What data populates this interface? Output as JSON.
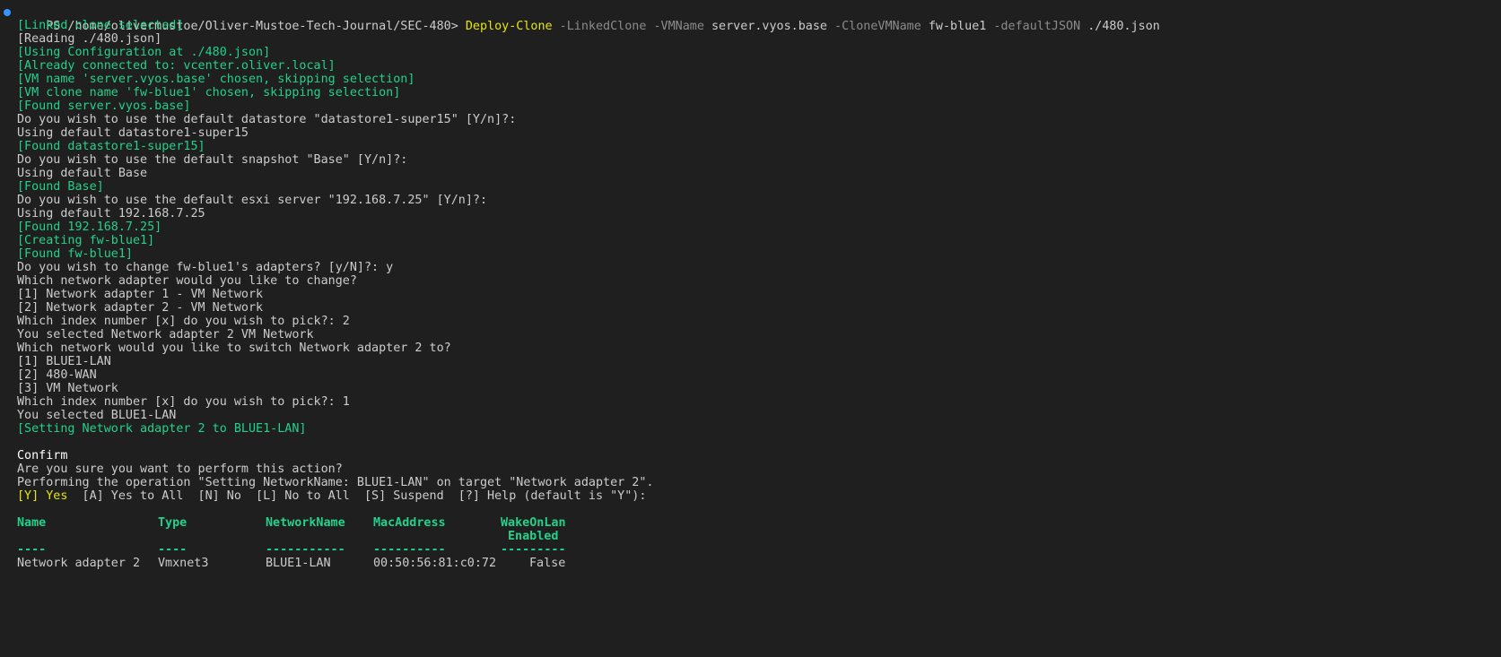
{
  "prompt": {
    "path": "PS /home/olivermustoe/Oliver-Mustoe-Tech-Journal/SEC-480>",
    "command": "Deploy-Clone",
    "args": [
      {
        "flag": "-LinkedClone",
        "value": ""
      },
      {
        "flag": "-VMName",
        "value": "server.vyos.base"
      },
      {
        "flag": "-CloneVMName",
        "value": "fw-blue1"
      },
      {
        "flag": "-defaultJSON",
        "value": "./480.json"
      }
    ]
  },
  "output": [
    {
      "text": "[Linked clone selected]",
      "color": "#23d18b"
    },
    {
      "text": "[Reading ./480.json]",
      "color": "#cccccc"
    },
    {
      "text": "[Using Configuration at ./480.json]",
      "color": "#23d18b"
    },
    {
      "text": "[Already connected to: vcenter.oliver.local]",
      "color": "#23d18b"
    },
    {
      "text": "[VM name 'server.vyos.base' chosen, skipping selection]",
      "color": "#23d18b"
    },
    {
      "text": "[VM clone name 'fw-blue1' chosen, skipping selection]",
      "color": "#23d18b"
    },
    {
      "text": "[Found server.vyos.base]",
      "color": "#23d18b"
    },
    {
      "text": "Do you wish to use the default datastore \"datastore1-super15\" [Y/n]?:",
      "color": "#cccccc"
    },
    {
      "text": "Using default datastore1-super15",
      "color": "#cccccc"
    },
    {
      "text": "[Found datastore1-super15]",
      "color": "#23d18b"
    },
    {
      "text": "Do you wish to use the default snapshot \"Base\" [Y/n]?:",
      "color": "#cccccc"
    },
    {
      "text": "Using default Base",
      "color": "#cccccc"
    },
    {
      "text": "[Found Base]",
      "color": "#23d18b"
    },
    {
      "text": "Do you wish to use the default esxi server \"192.168.7.25\" [Y/n]?:",
      "color": "#cccccc"
    },
    {
      "text": "Using default 192.168.7.25",
      "color": "#cccccc"
    },
    {
      "text": "[Found 192.168.7.25]",
      "color": "#23d18b"
    },
    {
      "text": "[Creating fw-blue1]",
      "color": "#23d18b"
    },
    {
      "text": "[Found fw-blue1]",
      "color": "#23d18b"
    },
    {
      "text": "Do you wish to change fw-blue1's adapters? [y/N]?: y",
      "color": "#cccccc"
    },
    {
      "text": "Which network adapter would you like to change?",
      "color": "#cccccc"
    },
    {
      "text": "[1] Network adapter 1 - VM Network",
      "color": "#cccccc"
    },
    {
      "text": "[2] Network adapter 2 - VM Network",
      "color": "#cccccc"
    },
    {
      "text": "Which index number [x] do you wish to pick?: 2",
      "color": "#cccccc"
    },
    {
      "text": "You selected Network adapter 2 VM Network",
      "color": "#cccccc"
    },
    {
      "text": "Which network would you like to switch Network adapter 2 to?",
      "color": "#cccccc"
    },
    {
      "text": "[1] BLUE1-LAN",
      "color": "#cccccc"
    },
    {
      "text": "[2] 480-WAN",
      "color": "#cccccc"
    },
    {
      "text": "[3] VM Network",
      "color": "#cccccc"
    },
    {
      "text": "Which index number [x] do you wish to pick?: 1",
      "color": "#cccccc"
    },
    {
      "text": "You selected BLUE1-LAN",
      "color": "#cccccc"
    },
    {
      "text": "[Setting Network adapter 2 to BLUE1-LAN]",
      "color": "#23d18b"
    },
    {
      "text": "",
      "color": "#cccccc"
    },
    {
      "text": "Confirm",
      "color": "#ffffff"
    },
    {
      "text": "Are you sure you want to perform this action?",
      "color": "#cccccc"
    },
    {
      "text": "Performing the operation \"Setting NetworkName: BLUE1-LAN\" on target \"Network adapter 2\".",
      "color": "#cccccc"
    }
  ],
  "confirm_choices": {
    "yes": "[Y] Yes",
    "rest": "  [A] Yes to All  [N] No  [L] No to All  [S] Suspend  [?] Help (default is \"Y\"):"
  },
  "table": {
    "headers": [
      "Name",
      "Type",
      "NetworkName",
      "MacAddress",
      "WakeOnLan"
    ],
    "header_second_line": "Enabled",
    "separators": [
      "----",
      "----",
      "-----------",
      "----------",
      "---------"
    ],
    "rows": [
      [
        "Network adapter 2",
        "Vmxnet3",
        "BLUE1-LAN",
        "00:50:56:81:c0:72",
        "False"
      ]
    ]
  },
  "colors": {
    "background": "#1f1f1f",
    "text": "#cccccc",
    "green": "#23d18b",
    "yellow": "#e5e510",
    "param": "#8b8b8b",
    "prompt_dot": "#3794ff"
  }
}
